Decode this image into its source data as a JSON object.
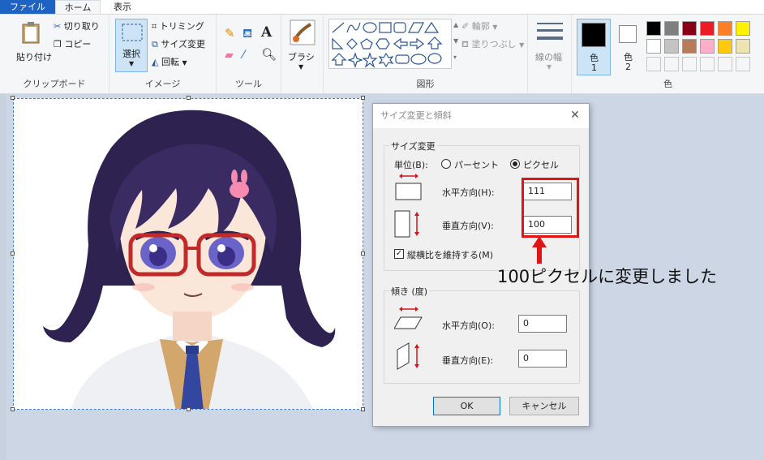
{
  "tabs": {
    "file": "ファイル",
    "home": "ホーム",
    "view": "表示"
  },
  "clipboard": {
    "paste": "貼り付け",
    "cut": "切り取り",
    "copy": "コピー",
    "label": "クリップボード"
  },
  "image": {
    "select": "選択",
    "crop": "トリミング",
    "resize": "サイズ変更",
    "rotate": "回転",
    "label": "イメージ"
  },
  "tools": {
    "label": "ツール"
  },
  "brush": {
    "label": "ブラシ"
  },
  "shapes": {
    "outline": "輪郭",
    "fill": "塗りつぶし",
    "label": "図形"
  },
  "size": {
    "label": "線の幅"
  },
  "colors": {
    "color1": "色",
    "color1_num": "1",
    "color2": "色",
    "color2_num": "2",
    "label": "色",
    "palette_row1": [
      "#000000",
      "#7f7f7f",
      "#880015",
      "#ed1c24",
      "#ff7f27",
      "#fff200"
    ],
    "palette_row2": [
      "#ffffff",
      "#c3c3c3",
      "#b97a57",
      "#ffaec9",
      "#ffc90e",
      "#efe4b0"
    ]
  },
  "dialog": {
    "title": "サイズ変更と傾斜",
    "resize_legend": "サイズ変更",
    "unit_label": "単位(B):",
    "percent": "パーセント",
    "pixel": "ピクセル",
    "horizontal_label": "水平方向(H):",
    "horizontal_value": "111",
    "vertical_label": "垂直方向(V):",
    "vertical_value": "100",
    "keep_ratio": "縦横比を維持する(M)",
    "skew_legend": "傾き (度)",
    "skew_h_label": "水平方向(O):",
    "skew_h_value": "0",
    "skew_v_label": "垂直方向(E):",
    "skew_v_value": "0",
    "ok": "OK",
    "cancel": "キャンセル"
  },
  "annotation": "100ピクセルに変更しました"
}
